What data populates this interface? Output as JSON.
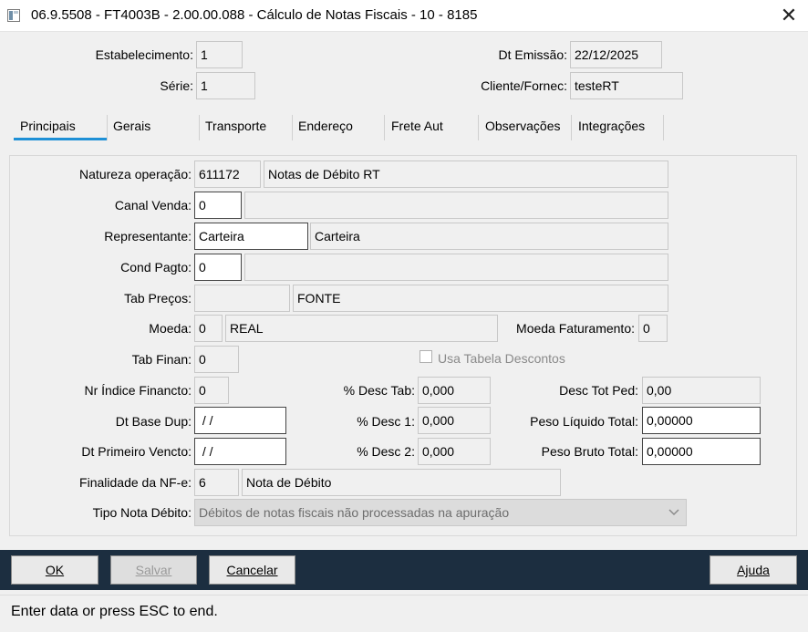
{
  "window": {
    "title": "06.9.5508 - FT4003B - 2.00.00.088 - Cálculo de Notas Fiscais - 10 - 8185",
    "close_glyph": "✕"
  },
  "header": {
    "estabelecimento_label": "Estabelecimento:",
    "estabelecimento_value": "1",
    "serie_label": "Série:",
    "serie_value": "1",
    "dt_emissao_label": "Dt Emissão:",
    "dt_emissao_value": "22/12/2025",
    "cliente_label": "Cliente/Fornec:",
    "cliente_value": "testeRT"
  },
  "tabs": [
    "Principais",
    "Gerais",
    "Transporte",
    "Endereço",
    "Frete Aut",
    "Observações",
    "Integrações"
  ],
  "active_tab": "Principais",
  "form": {
    "natureza_label": "Natureza operação:",
    "natureza_code": "611172",
    "natureza_desc": "Notas de Débito RT",
    "canal_label": "Canal Venda:",
    "canal_code": "0",
    "canal_desc": "",
    "representante_label": "Representante:",
    "representante_code": "Carteira",
    "representante_desc": "Carteira",
    "cond_label": "Cond Pagto:",
    "cond_code": "0",
    "cond_desc": "",
    "tabprecos_label": "Tab Preços:",
    "tabprecos_code": "",
    "tabprecos_desc": "FONTE",
    "moeda_label": "Moeda:",
    "moeda_code": "0",
    "moeda_desc": "REAL",
    "moeda_fat_label": "Moeda Faturamento:",
    "moeda_fat_value": "0",
    "tabfinan_label": "Tab Finan:",
    "tabfinan_value": "0",
    "usa_tabela_label": "Usa Tabela Descontos",
    "nr_indice_label": "Nr Índice Financto:",
    "nr_indice_value": "0",
    "desc_tab_label": "% Desc Tab:",
    "desc_tab_value": "0,000",
    "desc_tot_label": "Desc Tot Ped:",
    "desc_tot_value": "0,00",
    "dt_base_label": "Dt Base Dup:",
    "dt_base_value": " / /",
    "desc1_label": "% Desc 1:",
    "desc1_value": "0,000",
    "peso_liq_label": "Peso Líquido Total:",
    "peso_liq_value": "0,00000",
    "dt_primeiro_label": "Dt Primeiro Vencto:",
    "dt_primeiro_value": " / /",
    "desc2_label": "% Desc 2:",
    "desc2_value": "0,000",
    "peso_bruto_label": "Peso Bruto Total:",
    "peso_bruto_value": "0,00000",
    "finalidade_label": "Finalidade da NF-e:",
    "finalidade_code": "6",
    "finalidade_desc": "Nota de Débito",
    "tipo_nota_label": "Tipo Nota Débito:",
    "tipo_nota_value": "Débitos de notas fiscais não processadas na apuração"
  },
  "buttons": {
    "ok": "OK",
    "salvar": "Salvar",
    "cancelar": "Cancelar",
    "ajuda": "Ajuda"
  },
  "status": "Enter data or press ESC to end.",
  "colors": {
    "button_bar": "#1c2e40",
    "tab_accent": "#1e90d6"
  }
}
